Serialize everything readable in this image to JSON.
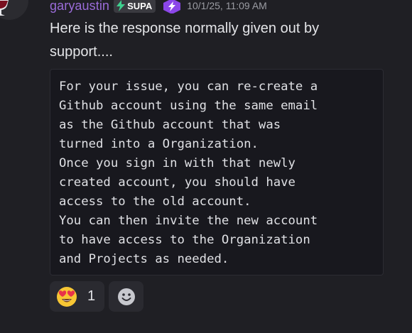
{
  "message": {
    "author": {
      "username": "garyaustin",
      "tag": "SUPA",
      "avatar_icon": "wine-glass-icon",
      "badge_icon": "nitro-hexagon-bolt-icon"
    },
    "timestamp": "10/1/25, 11:09 AM",
    "text_lines": [
      "Here is the response normally given out by",
      "support...."
    ],
    "code_lines": [
      "For your issue, you can re-create a",
      "Github account using the same email",
      "as the Github account that was",
      "turned into a Organization.",
      "Once you sign in with that newly",
      "created account, you should have",
      "access to the old account.",
      "You can then invite the new account",
      "to have access to the Organization",
      "and Projects as needed."
    ],
    "reactions": [
      {
        "emoji_icon": "heart-eyes-emoji-icon",
        "count": "1"
      }
    ],
    "add_reaction_icon": "smiley-add-reaction-icon"
  },
  "colors": {
    "background": "#1f1f24",
    "username": "#9a6cd8",
    "code_background": "#18181e",
    "badge_purple": "#8b46e8",
    "tag_bolt": "#3ecf8e"
  }
}
